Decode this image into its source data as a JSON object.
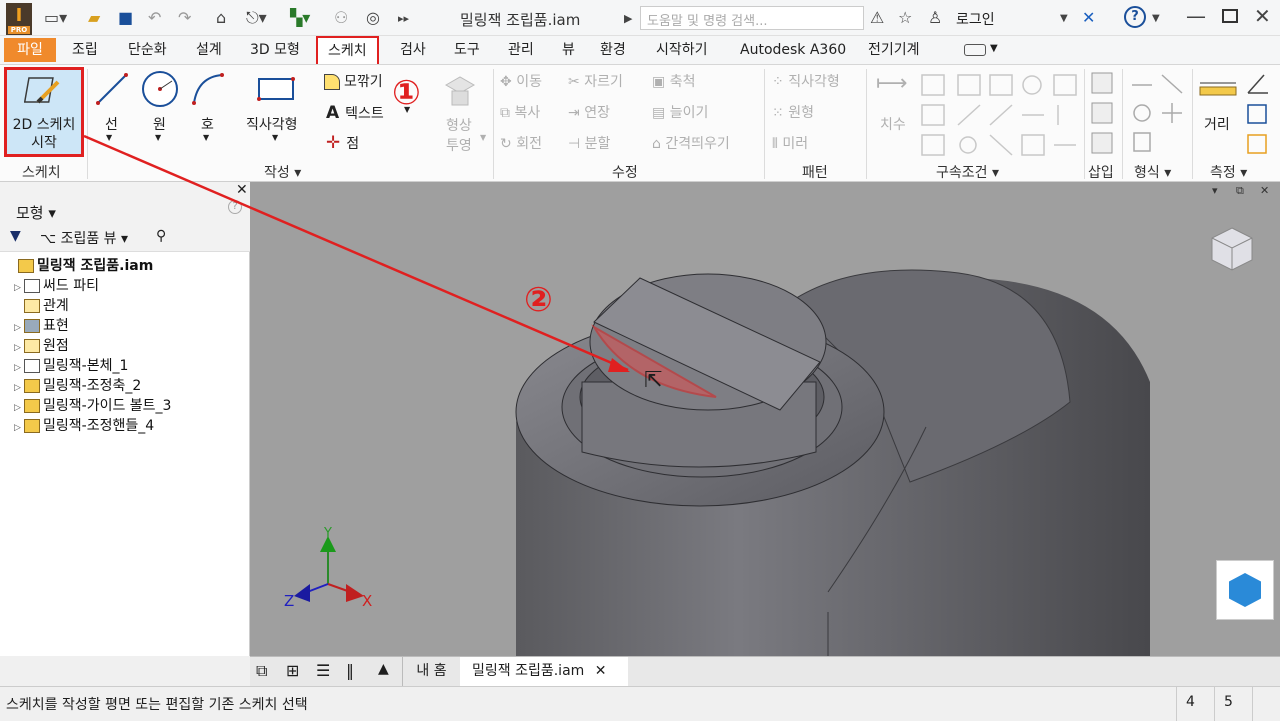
{
  "titlebar": {
    "app_icon": "I",
    "app_badge": "PRO",
    "document_title": "밀링잭 조립품.iam",
    "search_placeholder": "도움말 및 명령 검색...",
    "login": "로그인",
    "help": "?",
    "icons": [
      "new-icon",
      "open-icon",
      "save-icon",
      "undo-icon",
      "redo-icon",
      "home-icon",
      "return-icon",
      "select-icon",
      "appearance-icon",
      "more-icon",
      "x-exchange-icon",
      "star-icon",
      "user-icon",
      "minimize-icon",
      "maximize-icon",
      "close-icon"
    ]
  },
  "tabs": [
    "파일",
    "조립",
    "단순화",
    "설계",
    "3D 모형",
    "스케치",
    "검사",
    "도구",
    "관리",
    "뷰",
    "환경",
    "시작하기",
    "Autodesk A360",
    "전기기계"
  ],
  "ribbon": {
    "sketch_group": {
      "btn_label_1": "2D 스케치",
      "btn_label_2": "시작",
      "group_label": "스케치"
    },
    "create": {
      "line": "선",
      "circle": "원",
      "arc": "호",
      "rect": "직사각형",
      "fillet": "모깎기",
      "text": "텍스트",
      "point": "점",
      "project_1": "형상",
      "project_2": "투영",
      "group_label": "작성"
    },
    "modify": {
      "move": "이동",
      "trim": "자르기",
      "scale": "축척",
      "copy": "복사",
      "extend": "연장",
      "stretch": "늘이기",
      "rotate": "회전",
      "split": "분할",
      "offset": "간격띄우기",
      "group_label": "수정"
    },
    "pattern": {
      "rect": "직사각형",
      "circ": "원형",
      "mirror": "미러",
      "group_label": "패턴"
    },
    "constrain": {
      "dimension": "치수",
      "group_label": "구속조건"
    },
    "insert": {
      "group_label": "삽입"
    },
    "format": {
      "group_label": "형식"
    },
    "measure": {
      "distance": "거리",
      "group_label": "측정"
    }
  },
  "annotations": {
    "step1": "①",
    "step2": "②"
  },
  "browser": {
    "title": "모형",
    "view": "조립품 뷰",
    "items": [
      {
        "label": "밀링잭 조립품.iam",
        "bold": true
      },
      {
        "label": "써드 파티"
      },
      {
        "label": "관계"
      },
      {
        "label": "표현"
      },
      {
        "label": "원점"
      },
      {
        "label": "밀링잭-본체_1"
      },
      {
        "label": "밀링잭-조정축_2"
      },
      {
        "label": "밀링잭-가이드 볼트_3"
      },
      {
        "label": "밀링잭-조정핸들_4"
      }
    ]
  },
  "viewport": {
    "axis_x": "X",
    "axis_y": "Y",
    "axis_z": "Z"
  },
  "doc_tabs": {
    "home": "내 홈",
    "active": "밀링잭 조립품.iam",
    "close": "✕"
  },
  "status": {
    "message": "스케치를 작성할 평면 또는 편집할 기존 스케치 선택",
    "count1": "4",
    "count2": "5"
  },
  "colors": {
    "file_tab": "#f08a2c",
    "highlight": "#e02020",
    "viewport_bg": "#9f9f9f"
  }
}
